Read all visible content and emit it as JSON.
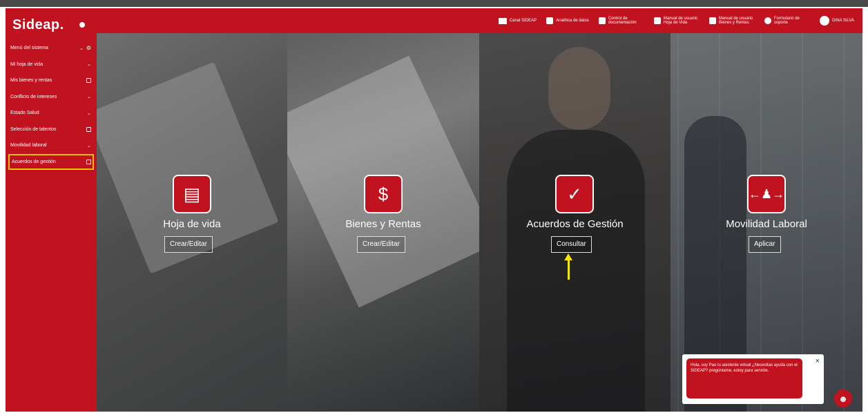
{
  "brand": {
    "logo": "Sideap."
  },
  "sidebar": {
    "items": [
      {
        "label": "Menú del sistema",
        "icons": [
          "chevron-down",
          "gear"
        ]
      },
      {
        "label": "Mi hoja de vida",
        "icons": [
          "chevron-down"
        ]
      },
      {
        "label": "Mis bienes y rentas",
        "icons": [
          "document"
        ]
      },
      {
        "label": "Conflicto de intereses",
        "icons": [
          "chevron-down"
        ]
      },
      {
        "label": "Estado Salud",
        "icons": [
          "chevron-down"
        ]
      },
      {
        "label": "Selección de talentos",
        "icons": [
          "window"
        ]
      },
      {
        "label": "Movilidad laboral",
        "icons": [
          "chevron-down"
        ]
      },
      {
        "label": "Acuerdos de gestión",
        "icons": [
          "window"
        ],
        "active": true
      }
    ]
  },
  "topbar": {
    "items": [
      {
        "label": "Canal SIDEAP",
        "icon": "video-camera-icon"
      },
      {
        "label": "Analítica de datos",
        "icon": "chart-icon"
      },
      {
        "label": "Control de documentación",
        "icon": "document-icon"
      },
      {
        "label": "Manual de usuario Hoja de Vida",
        "icon": "manual-icon"
      },
      {
        "label": "Manual de usuario Bienes y Rentas",
        "icon": "manual-icon"
      },
      {
        "label": "Formulario de soporte",
        "icon": "help-icon"
      },
      {
        "label": "GINA SILVA",
        "icon": "user-avatar-icon"
      }
    ]
  },
  "tiles": [
    {
      "title": "Hoja de vida",
      "button": "Crear/Editar",
      "icon": "resume-icon"
    },
    {
      "title": "Bienes y Rentas",
      "button": "Crear/Editar",
      "icon": "money-document-icon"
    },
    {
      "title": "Acuerdos de Gestión",
      "button": "Consultar",
      "icon": "badge-check-icon"
    },
    {
      "title": "Movilidad Laboral",
      "button": "Aplicar",
      "icon": "person-arrows-icon"
    }
  ],
  "chat": {
    "message": "Hola, soy Pao tu asistente virtual ¿Necesitas ayuda con el SIDEAP? pregúntame, estoy para servirte.",
    "close": "×"
  },
  "colors": {
    "brand_red": "#c1121f",
    "highlight_yellow": "#f2c200"
  }
}
